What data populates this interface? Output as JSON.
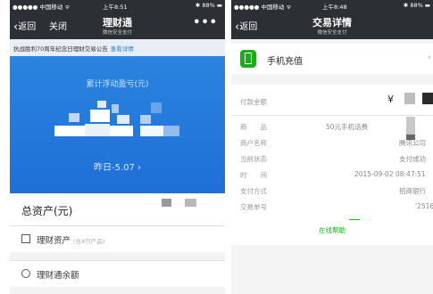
{
  "left": {
    "status": {
      "carrier": "●●●●● 中国移动 ᯤ",
      "time": "上午8:51",
      "battery": "88%"
    },
    "nav": {
      "back": "返回",
      "close": "关闭",
      "title": "理财通",
      "subtitle": "微信安全支付",
      "more": "•••"
    },
    "notice": {
      "text": "抗战胜利70周年纪念日理财交易公告",
      "link": "查看详情"
    },
    "hero": {
      "label": "累计浮动盈亏(元)",
      "yesterday": "昨日-5.07 ›"
    },
    "total": {
      "label": "总资产(元)"
    },
    "items": [
      {
        "label": "理财资产",
        "sub": "(含4只产品)"
      },
      {
        "label": "理财通余额",
        "sub": ""
      }
    ],
    "accent": "#1e6fd6"
  },
  "right": {
    "status": {
      "carrier": "●●●●● 中国移动 ᯤ",
      "time": "上午8:48",
      "battery": "88%"
    },
    "nav": {
      "back": "返回",
      "title": "交易详情",
      "subtitle": "微信安全支付"
    },
    "merchant": {
      "name": "手机充值",
      "icon": "phone-recharge-icon"
    },
    "amount_label": "付款金额",
    "yen": "¥",
    "rows": [
      {
        "k": "商　　品",
        "v": "50元手机话费"
      },
      {
        "k": "商户名称",
        "v": "腾讯公司"
      },
      {
        "k": "当前状态",
        "v": "支付成功"
      },
      {
        "k": "时　　间",
        "v": "2015-09-02 08:47:51"
      },
      {
        "k": "支付方式",
        "v": "招商银行"
      },
      {
        "k": "交易单号",
        "v": "'2516"
      }
    ],
    "help": "在线帮助",
    "accent": "#1aad19"
  }
}
